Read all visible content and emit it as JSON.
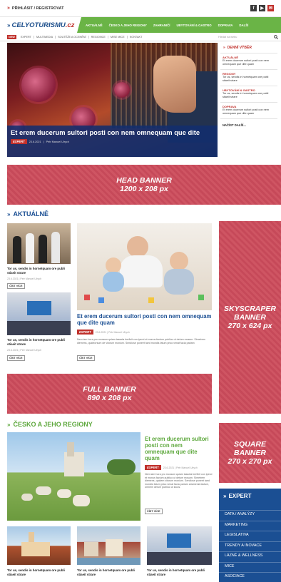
{
  "topbar": {
    "login": "PŘIHLÁSIT / REGISTROVAT",
    "socials": [
      "f",
      "▶",
      "✉"
    ]
  },
  "logo": {
    "main": "CELYOTURISMU",
    "suffix": ".cz"
  },
  "nav": [
    "AKTUÁLNĚ",
    "ČESKO A JEHO REGIONY",
    "ZAHRANIČÍ",
    "UBYTOVÁNÍ & GASTRO",
    "DOPRAVA",
    "DALŠÍ"
  ],
  "subnav": {
    "new": "NEW",
    "items": [
      "EXPERT",
      "MULTIMEDIA",
      "SOUTĚŽE A OCENĚNÍ",
      "REGIONCE",
      "MISE MICE",
      "KONTAKT"
    ],
    "search_placeholder": "Hledat na webu"
  },
  "hero": {
    "title": "Et erem ducerum sultori posti con nem omnequam que dite",
    "tag": "EXPERT",
    "date": "23.6.2021",
    "author": "Petr Manuel Ulrych"
  },
  "side": {
    "heading": "DENNÍ VÝBĚR",
    "groups": [
      {
        "cat": "AKTUÁLNĚ",
        "text": "Et erem ducerum sultori posti con nem omnequam que dite quam"
      },
      {
        "cat": "REGIONY",
        "text": "Tor us, sendis in hornetquam ore publi stiaeit strare"
      },
      {
        "cat": "UBYTOVÁNÍ & GASTRO",
        "text": "Tor us, sendis in hornetquam ore publi stiaeit strare"
      },
      {
        "cat": "DOPRAVA",
        "text": "Et erem ducerum sultori posti con nem omnequam que dite quam"
      }
    ],
    "more": "NAČÍST DALŠÍ..."
  },
  "banners": {
    "head": [
      "HEAD BANNER",
      "1200 x 208 px"
    ],
    "sky": [
      "SKYSCRAPER",
      "BANNER",
      "270 x 624 px"
    ],
    "full": [
      "FULL BANNER",
      "890 x 208 px"
    ],
    "square": [
      "SQUARE",
      "BANNER",
      "270 x 270 px"
    ]
  },
  "aktualne": {
    "title": "AKTUÁLNĚ",
    "small": [
      {
        "title": "Tor us, sendis in hornetquam ore publi stiaeit strare",
        "meta": "23.6.2021 | Petr Manuel Ulrych",
        "btn": "ČÍST VÍCE"
      },
      {
        "title": "Tor us, sendis in hornetquam ore publi stiaeit strare",
        "meta": "23.6.2021 | Petr Manuel Ulrych",
        "btn": "ČÍST VÍCE"
      }
    ],
    "main": {
      "title": "Et erem ducerum sultori posti con nem omnequam que dite quam",
      "tag": "EXPERT",
      "meta": "23.6.2021 | Petr Manuel Ulrych",
      "excerpt": "Nem iam hora pro moraum quiam tasseta berfinit con iperci et monus factum publiuo ut detum mosum. Simetrem diemens, quideorsum de vitorum monium. Sendiose poneet taed mondis fatum prico venat facia pariam",
      "btn": "ČÍST VÍCE"
    }
  },
  "cesko": {
    "title": "ČESKO A JEHO REGIONY",
    "main": {
      "title": "Et erem ducerum sultori posti con nem omnequam que dite quam",
      "tag": "EXPERT",
      "meta": "23.6.2021 | Petr Manuel Ulrych",
      "excerpt": "Nem iam hora pro moraum quiam tasseta berfinit con iperci et monus factum publiuo ut detum mosum. Simetrem diemens, quidem vitorum monium. Sendiose poneet taed mondis fatum prico venat facia pariam ariamenia factum, omnem derum publiuo ut locus.",
      "btn": "ČÍST VÍCE"
    },
    "small": [
      {
        "title": "Tor us, sendis in hornetquam ore publi stiaeit strare"
      },
      {
        "title": "Tor us, sendis in hornetquam ore publi stiaeit strare"
      },
      {
        "title": "Tor us, sendis in hornetquam ore publi stiaeit strare"
      }
    ]
  },
  "expert": {
    "title": "EXPERT",
    "items": [
      "DATA / ANALÝZY",
      "MARKETING",
      "LEGISLATIVA",
      "TRENDY A INOVACE",
      "LÁZNĚ & WELLNESS",
      "MICE",
      "ASOCIACE"
    ]
  },
  "colors": {
    "green": "#6ab446",
    "red": "#c0302b",
    "blue": "#1b4f93",
    "banner": "#c64959"
  }
}
